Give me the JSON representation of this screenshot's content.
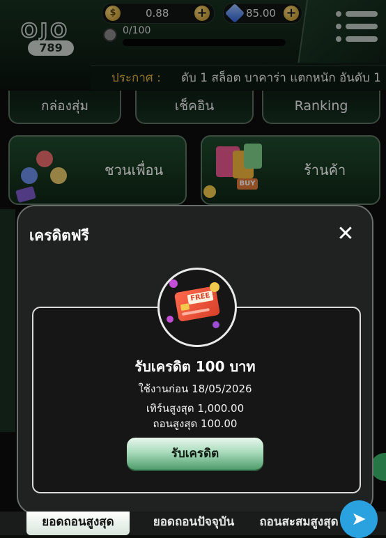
{
  "header": {
    "logo_text": "OJO",
    "logo_number": "789",
    "coin_balance": "0.88",
    "coin_symbol": "$",
    "gem_balance": "85.00",
    "plus_symbol": "+",
    "xp_text": "0/100",
    "xp_progress": 0
  },
  "announcement": {
    "label": "ประกาศ :",
    "text": "ดับ 1 สล็อต บาคาร่า แตกหนัก อันดับ 1"
  },
  "nav": {
    "items": [
      "กล่องสุ่ม",
      "เช็คอิน",
      "Ranking"
    ]
  },
  "cards": {
    "invite_label": "ชวนเพื่อน",
    "shop_label": "ร้านค้า",
    "buy_tag": "BUY"
  },
  "modal": {
    "title": "เครดิตฟรี",
    "close_symbol": "✕",
    "card_free_label": "FREE",
    "heading": "รับเครดิต 100 บาท",
    "use_before": "ใช้งานก่อน 18/05/2026",
    "max_turnover": "เทิร์นสูงสุด 1,000.00",
    "max_withdraw": "ถอนสูงสุด 100.00",
    "claim_button": "รับเครดิต"
  },
  "bottom_tabs": {
    "items": [
      "ยอดถอนสูงสุด",
      "ยอดถอนปัจจุบัน",
      "ถอนสะสมสูงสุด"
    ],
    "active_index": 0
  },
  "colors": {
    "accent_green": "#1f4a2c",
    "announce_label": "#e4b23c",
    "claim_button": "#a9dcbc"
  }
}
